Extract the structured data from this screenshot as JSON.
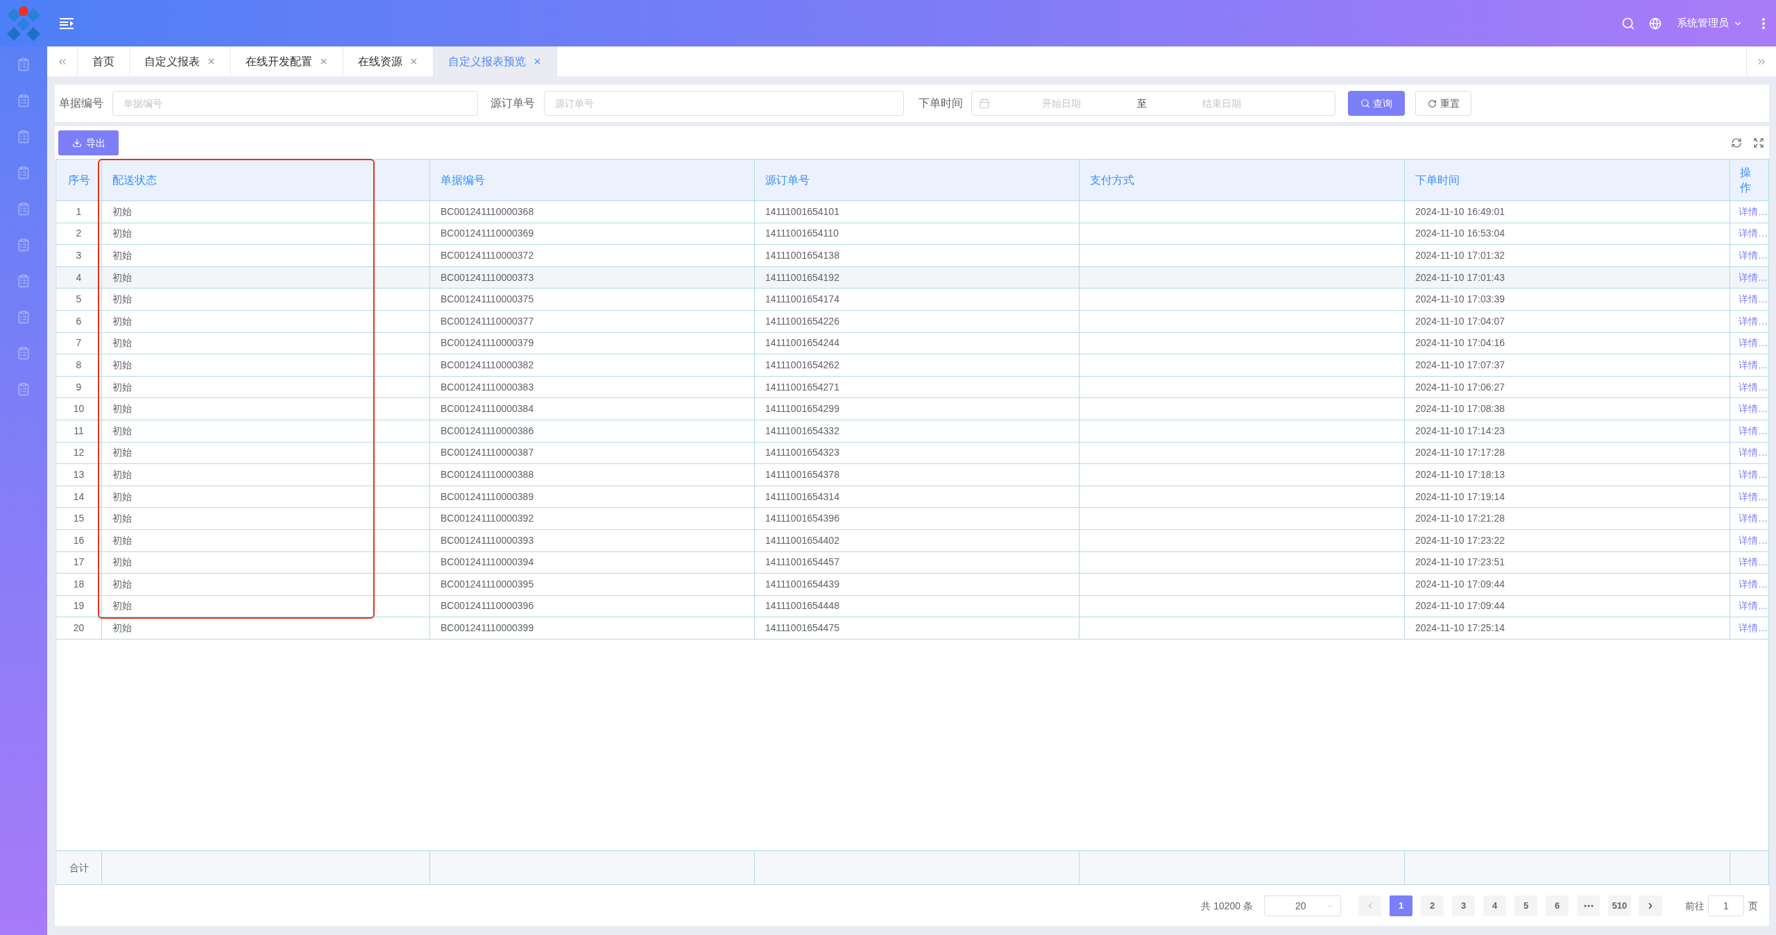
{
  "header": {
    "user": "系统管理员"
  },
  "tabs": [
    {
      "label": "首页",
      "closable": false,
      "selected": false
    },
    {
      "label": "自定义报表",
      "closable": true,
      "selected": false
    },
    {
      "label": "在线开发配置",
      "closable": true,
      "selected": false
    },
    {
      "label": "在线资源",
      "closable": true,
      "selected": false
    },
    {
      "label": "自定义报表预览",
      "closable": true,
      "selected": true
    }
  ],
  "filters": [
    {
      "kind": "text",
      "label": "单据编号",
      "placeholder": "单据编号"
    },
    {
      "kind": "text",
      "label": "源订单号",
      "placeholder": "源订单号"
    },
    {
      "kind": "daterange",
      "label": "下单时间",
      "start_placeholder": "开始日期",
      "separator": "至",
      "end_placeholder": "结束日期"
    }
  ],
  "filter_buttons": [
    {
      "kind": "primary",
      "label": "查询"
    },
    {
      "kind": "default",
      "label": "重置"
    }
  ],
  "toolbar": {
    "export_label": "导出"
  },
  "table": {
    "columns": [
      {
        "label": "序号",
        "kind": "index"
      },
      {
        "label": "配送状态",
        "kind": "text"
      },
      {
        "label": "单据编号",
        "kind": "text"
      },
      {
        "label": "源订单号",
        "kind": "text"
      },
      {
        "label": "支付方式",
        "kind": "text"
      },
      {
        "label": "下单时间",
        "kind": "text"
      },
      {
        "label": "操作",
        "kind": "link"
      }
    ],
    "rows": [
      {
        "index": "1",
        "status": "初始",
        "doc_no": "BC001241110000368",
        "source_no": "14111001654101",
        "order_time": "2024-11-10 16:49:01",
        "action": "详情…",
        "hovered": false
      },
      {
        "index": "2",
        "status": "初始",
        "doc_no": "BC001241110000369",
        "source_no": "14111001654110",
        "order_time": "2024-11-10 16:53:04",
        "action": "详情…",
        "hovered": false
      },
      {
        "index": "3",
        "status": "初始",
        "doc_no": "BC001241110000372",
        "source_no": "14111001654138",
        "order_time": "2024-11-10 17:01:32",
        "action": "详情…",
        "hovered": false
      },
      {
        "index": "4",
        "status": "初始",
        "doc_no": "BC001241110000373",
        "source_no": "14111001654192",
        "order_time": "2024-11-10 17:01:43",
        "action": "详情…",
        "hovered": true
      },
      {
        "index": "5",
        "status": "初始",
        "doc_no": "BC001241110000375",
        "source_no": "14111001654174",
        "order_time": "2024-11-10 17:03:39",
        "action": "详情…",
        "hovered": false
      },
      {
        "index": "6",
        "status": "初始",
        "doc_no": "BC001241110000377",
        "source_no": "14111001654226",
        "order_time": "2024-11-10 17:04:07",
        "action": "详情…",
        "hovered": false
      },
      {
        "index": "7",
        "status": "初始",
        "doc_no": "BC001241110000379",
        "source_no": "14111001654244",
        "order_time": "2024-11-10 17:04:16",
        "action": "详情…",
        "hovered": false
      },
      {
        "index": "8",
        "status": "初始",
        "doc_no": "BC001241110000382",
        "source_no": "14111001654262",
        "order_time": "2024-11-10 17:07:37",
        "action": "详情…",
        "hovered": false
      },
      {
        "index": "9",
        "status": "初始",
        "doc_no": "BC001241110000383",
        "source_no": "14111001654271",
        "order_time": "2024-11-10 17:06:27",
        "action": "详情…",
        "hovered": false
      },
      {
        "index": "10",
        "status": "初始",
        "doc_no": "BC001241110000384",
        "source_no": "14111001654299",
        "order_time": "2024-11-10 17:08:38",
        "action": "详情…",
        "hovered": false
      },
      {
        "index": "11",
        "status": "初始",
        "doc_no": "BC001241110000386",
        "source_no": "14111001654332",
        "order_time": "2024-11-10 17:14:23",
        "action": "详情…",
        "hovered": false
      },
      {
        "index": "12",
        "status": "初始",
        "doc_no": "BC001241110000387",
        "source_no": "14111001654323",
        "order_time": "2024-11-10 17:17:28",
        "action": "详情…",
        "hovered": false
      },
      {
        "index": "13",
        "status": "初始",
        "doc_no": "BC001241110000388",
        "source_no": "14111001654378",
        "order_time": "2024-11-10 17:18:13",
        "action": "详情…",
        "hovered": false
      },
      {
        "index": "14",
        "status": "初始",
        "doc_no": "BC001241110000389",
        "source_no": "14111001654314",
        "order_time": "2024-11-10 17:19:14",
        "action": "详情…",
        "hovered": false
      },
      {
        "index": "15",
        "status": "初始",
        "doc_no": "BC001241110000392",
        "source_no": "14111001654396",
        "order_time": "2024-11-10 17:21:28",
        "action": "详情…",
        "hovered": false
      },
      {
        "index": "16",
        "status": "初始",
        "doc_no": "BC001241110000393",
        "source_no": "14111001654402",
        "order_time": "2024-11-10 17:23:22",
        "action": "详情…",
        "hovered": false
      },
      {
        "index": "17",
        "status": "初始",
        "doc_no": "BC001241110000394",
        "source_no": "14111001654457",
        "order_time": "2024-11-10 17:23:51",
        "action": "详情…",
        "hovered": false
      },
      {
        "index": "18",
        "status": "初始",
        "doc_no": "BC001241110000395",
        "source_no": "14111001654439",
        "order_time": "2024-11-10 17:09:44",
        "action": "详情…",
        "hovered": false
      },
      {
        "index": "19",
        "status": "初始",
        "doc_no": "BC001241110000396",
        "source_no": "14111001654448",
        "order_time": "2024-11-10 17:09:44",
        "action": "详情…",
        "hovered": false
      },
      {
        "index": "20",
        "status": "初始",
        "doc_no": "BC001241110000399",
        "source_no": "14111001654475",
        "order_time": "2024-11-10 17:25:14",
        "action": "详情…",
        "hovered": false
      }
    ],
    "footer": {
      "label": "合计"
    }
  },
  "pagination": {
    "total": "共 10200 条",
    "page_size": "20",
    "prev_disabled": true,
    "next_disabled": false,
    "pages": [
      {
        "kind": "page",
        "label": "1",
        "selected": true
      },
      {
        "kind": "page",
        "label": "2",
        "selected": false
      },
      {
        "kind": "page",
        "label": "3",
        "selected": false
      },
      {
        "kind": "page",
        "label": "4",
        "selected": false
      },
      {
        "kind": "page",
        "label": "5",
        "selected": false
      },
      {
        "kind": "page",
        "label": "6",
        "selected": false
      },
      {
        "kind": "more",
        "selected": false
      },
      {
        "kind": "page",
        "label": "510",
        "selected": false
      }
    ],
    "jump": {
      "prefix": "前往",
      "value": "1",
      "suffix": "页"
    }
  }
}
